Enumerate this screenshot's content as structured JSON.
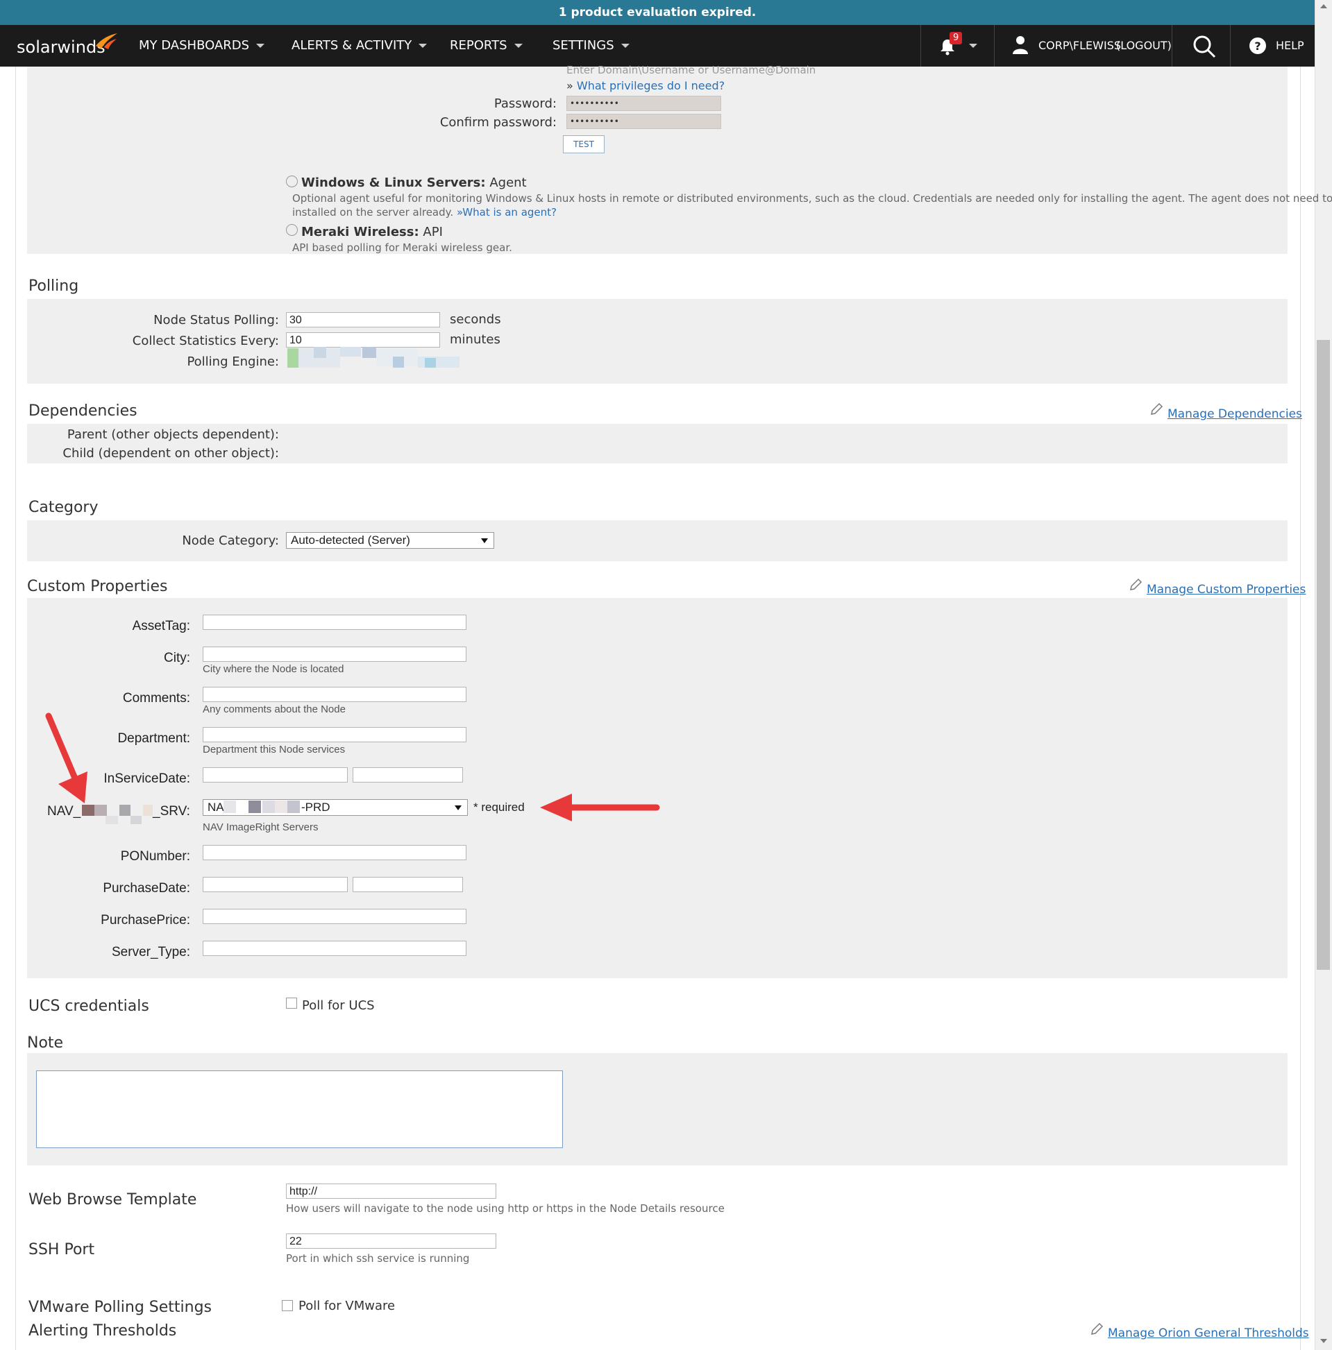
{
  "banner": {
    "text": "1 product evaluation expired."
  },
  "navbar": {
    "logo": "solarwinds",
    "items": [
      {
        "label": "MY DASHBOARDS"
      },
      {
        "label": "ALERTS & ACTIVITY"
      },
      {
        "label": "REPORTS"
      },
      {
        "label": "SETTINGS"
      }
    ],
    "notification_count": "9",
    "user": "CORP\\FLEWISS",
    "logout": "(LOGOUT)",
    "help": "HELP"
  },
  "credentials": {
    "username_hint": "Enter Domain\\Username or Username@Domain",
    "privileges_prefix": "»",
    "privileges_link": "What privileges do I need?",
    "password_label": "Password:",
    "password_value": "••••••••••",
    "confirm_label": "Confirm password:",
    "confirm_value": "••••••••••",
    "test_button": "TEST"
  },
  "polling_methods": {
    "windows_linux": {
      "title": "Windows & Linux Servers:",
      "suffix": "Agent",
      "desc_line1": "Optional agent useful for monitoring Windows & Linux hosts in remote or distributed environments, such as the cloud. Credentials are needed only for installing the agent. The agent does not need to be",
      "desc_line2": "installed on the server already.",
      "link_prefix": "»",
      "link": "What is an agent?"
    },
    "meraki": {
      "title": "Meraki Wireless:",
      "suffix": "API",
      "desc": "API based polling for Meraki wireless gear."
    }
  },
  "polling": {
    "title": "Polling",
    "status_label": "Node Status Polling:",
    "status_value": "30",
    "status_unit": "seconds",
    "stats_label": "Collect Statistics Every:",
    "stats_value": "10",
    "stats_unit": "minutes",
    "engine_label": "Polling Engine:"
  },
  "dependencies": {
    "title": "Dependencies",
    "manage_link": "Manage Dependencies",
    "parent_label": "Parent (other objects dependent):",
    "child_label": "Child (dependent on other object):"
  },
  "category": {
    "title": "Category",
    "label": "Node Category:",
    "selected": "Auto-detected (Server)"
  },
  "custom_properties": {
    "title": "Custom Properties",
    "manage_link": "Manage Custom Properties",
    "asset_tag": "AssetTag:",
    "city": "City:",
    "city_hint": "City where the Node is located",
    "comments": "Comments:",
    "comments_hint": "Any comments about the Node",
    "department": "Department:",
    "department_hint": "Department this Node services",
    "in_service_date": "InServiceDate:",
    "nav_label_prefix": "NAV_",
    "nav_label_suffix": "_SRV:",
    "nav_value_prefix": "NA",
    "nav_value_suffix": "-PRD",
    "nav_required": "* required",
    "nav_hint": "NAV ImageRight Servers",
    "po_number": "PONumber:",
    "purchase_date": "PurchaseDate:",
    "purchase_price": "PurchasePrice:",
    "server_type": "Server_Type:"
  },
  "ucs": {
    "title": "UCS credentials",
    "checkbox": "Poll for UCS"
  },
  "note": {
    "title": "Note"
  },
  "web_browse": {
    "title": "Web Browse Template",
    "value": "http://",
    "hint": "How users will navigate to the node using http or https in the Node Details resource"
  },
  "ssh": {
    "title": "SSH Port",
    "value": "22",
    "hint": "Port in which ssh service is running"
  },
  "vmware": {
    "title": "VMware Polling Settings",
    "checkbox": "Poll for VMware"
  },
  "alerting": {
    "title": "Alerting Thresholds",
    "manage_link": "Manage Orion General Thresholds"
  },
  "colors": {
    "banner": "#297994",
    "navbar": "#1b1b1b",
    "panel": "#efeff0",
    "link": "#2a6fb6",
    "arrow": "#e8393a",
    "badge": "#d4262b"
  }
}
